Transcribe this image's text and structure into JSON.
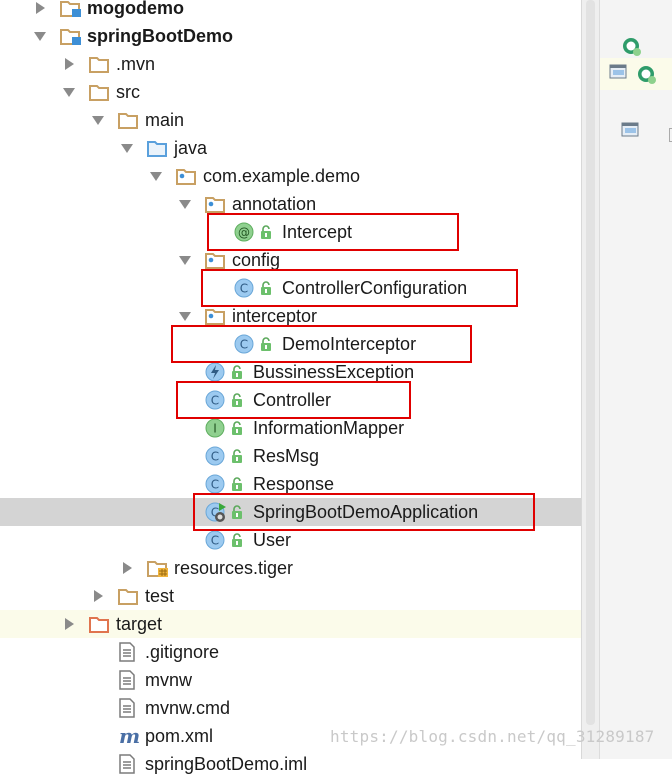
{
  "tree": {
    "rows": [
      {
        "label": "mogodemo",
        "bold": true,
        "arrow": "right",
        "icon": "module-folder-icon"
      },
      {
        "label": "springBootDemo",
        "bold": true,
        "arrow": "down",
        "icon": "module-folder-icon"
      },
      {
        "label": ".mvn",
        "arrow": "right",
        "icon": "folder-icon"
      },
      {
        "label": "src",
        "arrow": "down",
        "icon": "folder-icon"
      },
      {
        "label": "main",
        "arrow": "down",
        "icon": "folder-icon"
      },
      {
        "label": "java",
        "arrow": "down",
        "icon": "source-folder-icon"
      },
      {
        "label": "com.example.demo",
        "arrow": "down",
        "icon": "package-icon"
      },
      {
        "label": "annotation",
        "arrow": "down",
        "icon": "package-icon"
      },
      {
        "label": "Intercept",
        "arrow": "none",
        "icon": "annotation-icon",
        "lock": true
      },
      {
        "label": "config",
        "arrow": "down",
        "icon": "package-icon"
      },
      {
        "label": "ControllerConfiguration",
        "arrow": "none",
        "icon": "class-icon",
        "lock": true
      },
      {
        "label": "interceptor",
        "arrow": "down",
        "icon": "package-icon"
      },
      {
        "label": "DemoInterceptor",
        "arrow": "none",
        "icon": "class-icon",
        "lock": true
      },
      {
        "label": "BussinessException",
        "arrow": "none",
        "icon": "exception-class-icon",
        "lock": true
      },
      {
        "label": "Controller",
        "arrow": "none",
        "icon": "class-icon",
        "lock": true
      },
      {
        "label": "InformationMapper",
        "arrow": "none",
        "icon": "interface-icon",
        "lock": true
      },
      {
        "label": "ResMsg",
        "arrow": "none",
        "icon": "class-icon",
        "lock": true
      },
      {
        "label": "Response",
        "arrow": "none",
        "icon": "class-icon",
        "lock": true
      },
      {
        "label": "SpringBootDemoApplication",
        "arrow": "none",
        "icon": "spring-boot-app-icon",
        "lock": true,
        "selected": true
      },
      {
        "label": "User",
        "arrow": "none",
        "icon": "class-icon",
        "lock": true
      },
      {
        "label": "resources.tiger",
        "arrow": "right",
        "icon": "resources-folder-icon"
      },
      {
        "label": "test",
        "arrow": "right",
        "icon": "folder-icon"
      },
      {
        "label": "target",
        "arrow": "right",
        "icon": "excluded-folder-icon",
        "hover": true
      },
      {
        "label": ".gitignore",
        "arrow": "none",
        "icon": "text-file-icon"
      },
      {
        "label": "mvnw",
        "arrow": "none",
        "icon": "text-file-icon"
      },
      {
        "label": "mvnw.cmd",
        "arrow": "none",
        "icon": "text-file-icon"
      },
      {
        "label": "pom.xml",
        "arrow": "none",
        "icon": "maven-icon"
      },
      {
        "label": "springBootDemo.iml",
        "arrow": "none",
        "icon": "text-file-icon"
      }
    ]
  },
  "colors": {
    "folder": "#c8a063",
    "class_icon": "#9ccaf0",
    "interface_icon": "#8fd08f",
    "highlight": "#e00000",
    "selected_row": "#d4d4d4"
  },
  "watermark": "https://blog.csdn.net/qq_31289187"
}
